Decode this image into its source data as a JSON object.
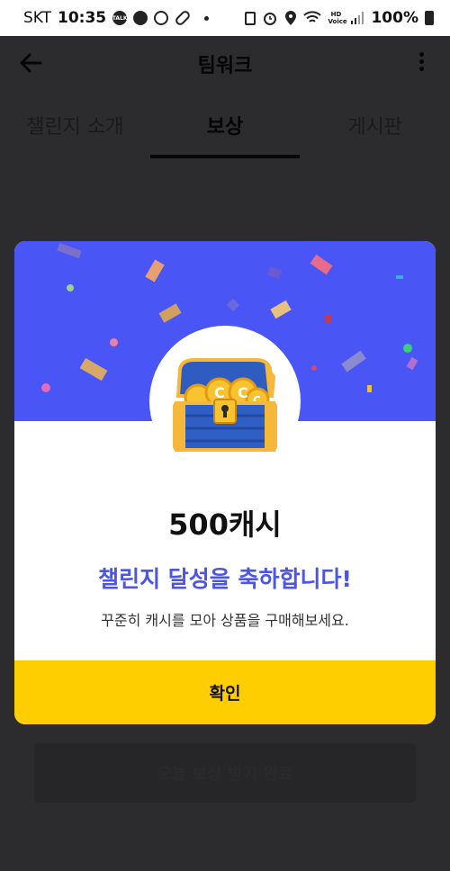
{
  "status_bar": {
    "carrier": "SKT",
    "time": "10:35",
    "notification_icons": [
      "kakaotalk-icon",
      "app-icon",
      "soccer-icon",
      "pill-icon"
    ],
    "system_icons": [
      "sim-icon",
      "alarm-icon",
      "location-icon",
      "wifi-icon",
      "hd-voice-icon",
      "signal-icon"
    ],
    "hd_voice_label": "HD Voice",
    "battery": "100%"
  },
  "header": {
    "title": "팀워크",
    "back_icon": "arrow-left-icon",
    "menu_icon": "more-vertical-icon"
  },
  "tabs": [
    {
      "label": "챌린지 소개",
      "active": false
    },
    {
      "label": "보상",
      "active": true
    },
    {
      "label": "게시판",
      "active": false
    }
  ],
  "bottom_button": {
    "label": "오늘 보상 받기 완료"
  },
  "modal": {
    "banner_color": "#4a55f5",
    "icon": "treasure-chest-icon",
    "reward_amount": "500캐시",
    "congrats": "챌린지 달성을 축하합니다!",
    "subtext": "꾸준히 캐시를 모아 상품을 구매해보세요.",
    "confirm_label": "확인",
    "confirm_color": "#fece00",
    "accent_color": "#4b55e6"
  }
}
